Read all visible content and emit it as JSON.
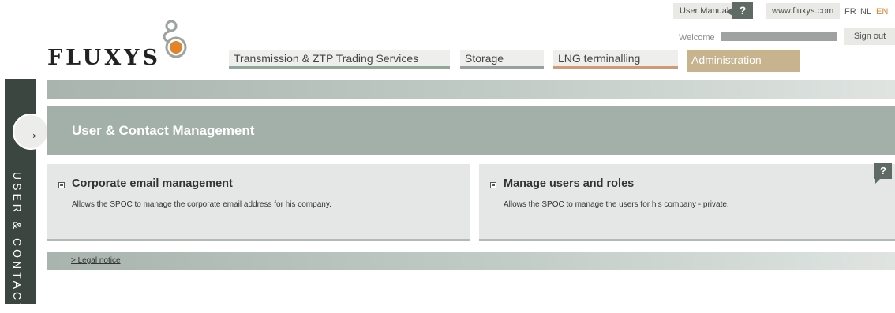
{
  "utility": {
    "user_manual": "User Manual",
    "help": "?",
    "website": "www.fluxys.com",
    "languages": [
      "FR",
      "NL",
      "EN"
    ],
    "active_language": "EN",
    "welcome": "Welcome",
    "sign_out": "Sign out"
  },
  "logo": {
    "text": "FLUXYS"
  },
  "nav": {
    "items": [
      {
        "label": "Transmission & ZTP Trading Services",
        "underline": "#8fa89a"
      },
      {
        "label": "Storage",
        "underline": "#9aa0a0"
      },
      {
        "label": "LNG terminalling",
        "underline": "#d39a72"
      },
      {
        "label": "Administration",
        "underline": "#c7b48f"
      }
    ],
    "active": "Administration"
  },
  "side_tab": {
    "arrow": "→",
    "label": "USER & CONTACT"
  },
  "main": {
    "title": "User & Contact Management",
    "help": "?",
    "cards": [
      {
        "title": "Corporate email management",
        "description": "Allows the SPOC to manage the corporate email address for his company.",
        "icon": "mailbox-icon"
      },
      {
        "title": "Manage users and roles",
        "description": "Allows the SPOC to manage the users for his company - private.",
        "icon": "mailbox-icon"
      }
    ]
  },
  "footer": {
    "legal": "> Legal notice"
  },
  "colors": {
    "accent_orange": "#e0852b",
    "band": "#a3b0a9",
    "active_tab": "#c7b48f",
    "side_tab": "#3c4641"
  }
}
